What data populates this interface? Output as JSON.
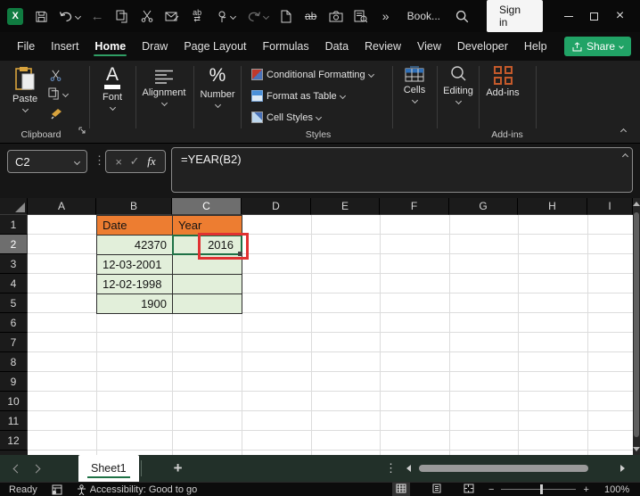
{
  "titlebar": {
    "workbook_title": "Book...",
    "sign_in": "Sign in",
    "glyphs": {
      "back": "←",
      "find_ab": "ab",
      "find_arrows": "⇄",
      "strikethrough": "ab",
      "more": "»",
      "close": "×",
      "dots": "⋮"
    }
  },
  "tabs": {
    "items": [
      "File",
      "Insert",
      "Home",
      "Draw",
      "Page Layout",
      "Formulas",
      "Data",
      "Review",
      "View",
      "Developer",
      "Help"
    ],
    "active": "Home",
    "share": "Share"
  },
  "ribbon": {
    "paste": "Paste",
    "clipboard_group": "Clipboard",
    "font_glyph": "A",
    "font": "Font",
    "alignment": "Alignment",
    "number_glyph": "%",
    "number": "Number",
    "conditional_formatting": "Conditional Formatting",
    "format_as_table": "Format as Table",
    "cell_styles": "Cell Styles",
    "styles_group": "Styles",
    "cells": "Cells",
    "editing": "Editing",
    "addins": "Add-ins",
    "addins_group": "Add-ins"
  },
  "formula_bar": {
    "name_box": "C2",
    "cancel": "×",
    "enter": "✓",
    "fx": "fx",
    "formula": "=YEAR(B2)"
  },
  "grid": {
    "columns": [
      "A",
      "B",
      "C",
      "D",
      "E",
      "F",
      "G",
      "H",
      "I"
    ],
    "rows": [
      "1",
      "2",
      "3",
      "4",
      "5",
      "6",
      "7",
      "8",
      "9",
      "10",
      "11",
      "12"
    ],
    "selected_cell": "C2",
    "cells": {
      "B1": "Date",
      "C1": "Year",
      "B2": "42370",
      "C2": "2016",
      "B3": "12-03-2001",
      "B4": "12-02-1998",
      "B5": "1900"
    },
    "colors": {
      "header_fill": "#ED7D31",
      "data_fill": "#E2EFDA",
      "annotation_red": "#E03131",
      "selection_green": "#1E7145"
    }
  },
  "sheet_bar": {
    "active_tab": "Sheet1",
    "add_sheet": "+"
  },
  "status_bar": {
    "mode": "Ready",
    "accessibility": "Accessibility: Good to go",
    "zoom_minus": "−",
    "zoom_plus": "+",
    "zoom_level": "100%"
  }
}
